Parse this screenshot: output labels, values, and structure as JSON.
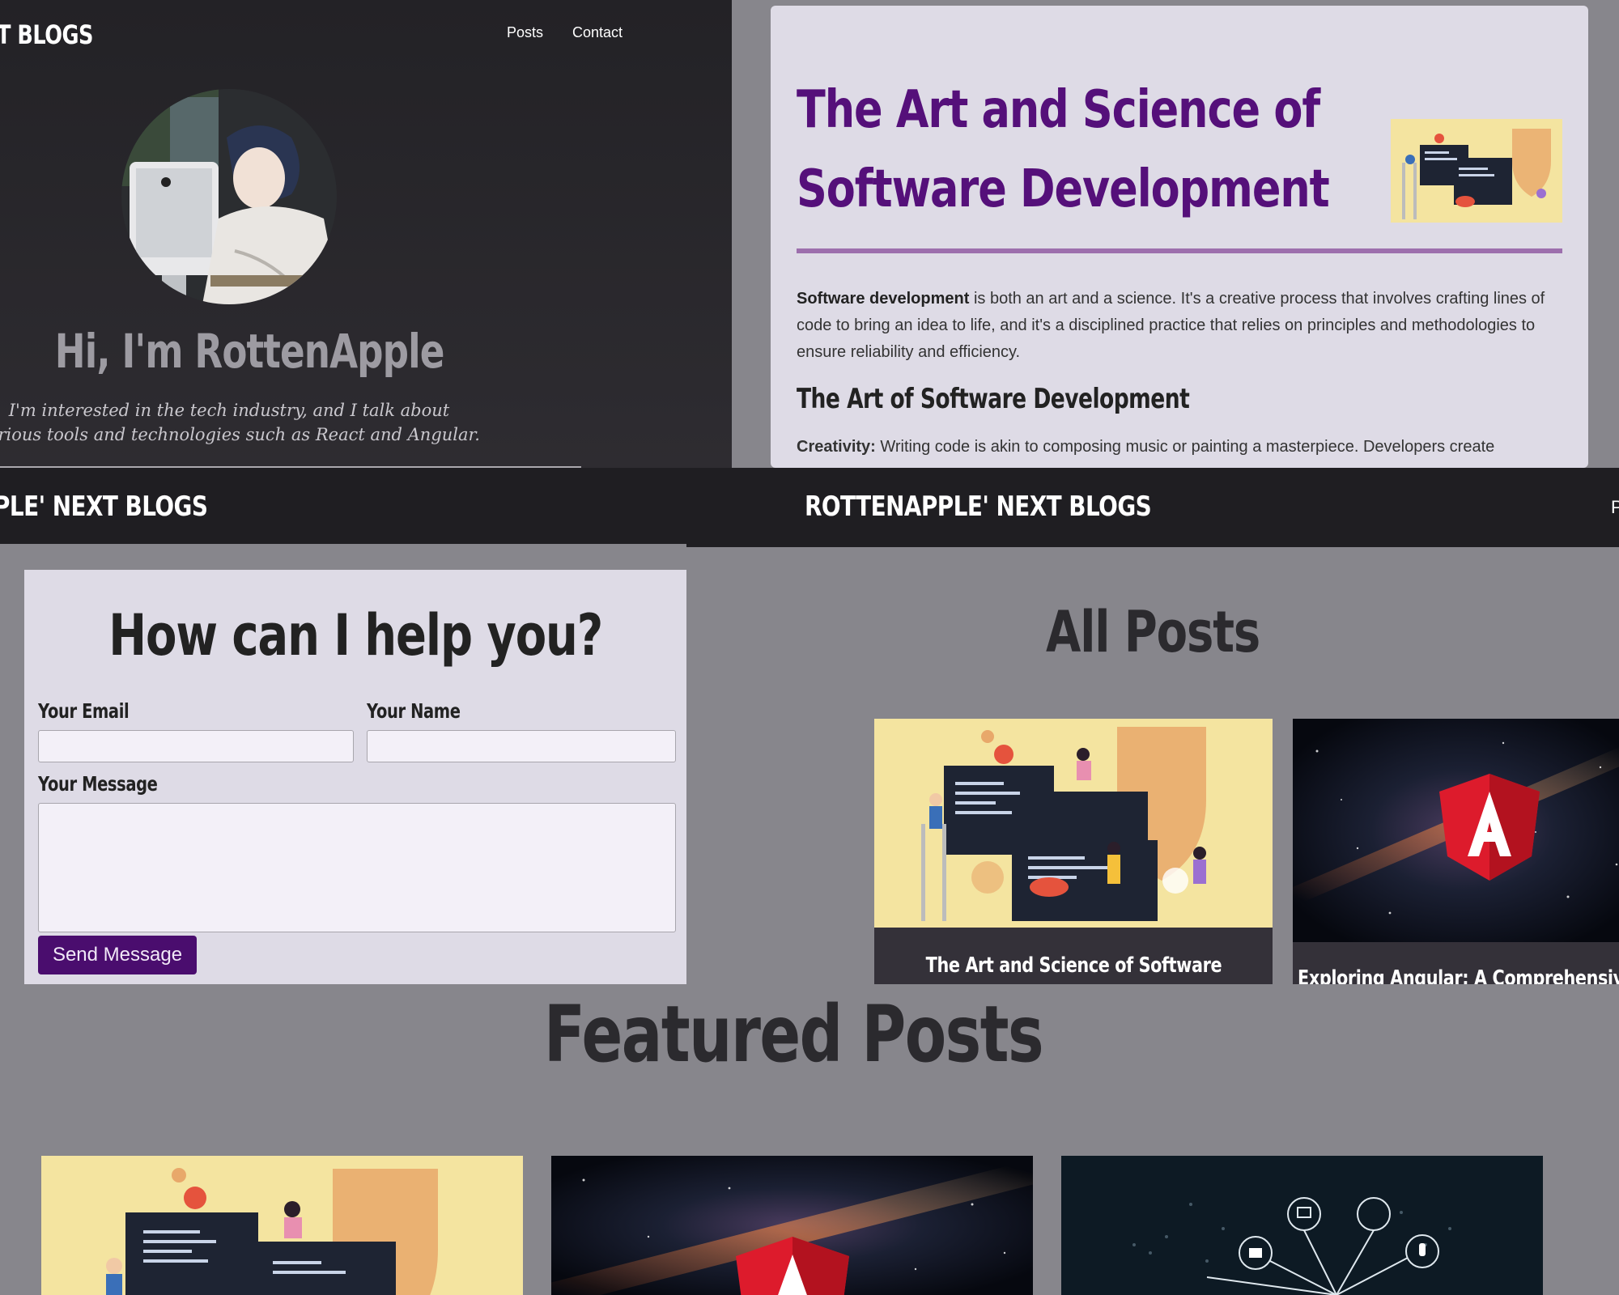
{
  "hero": {
    "brand": "T BLOGS",
    "nav": {
      "posts": "Posts",
      "contact": "Contact"
    },
    "title": "Hi, I'm RottenApple",
    "bio_line1": "I'm interested in the tech industry, and I talk about",
    "bio_line2": "various tools and technologies such as React and Angular."
  },
  "article": {
    "title_line1": "The Art and Science of",
    "title_line2": "Software Development",
    "p1_bold": "Software development",
    "p1_rest": " is both an art and a science. It's a creative process that involves crafting lines of code to bring an idea to life, and it's a disciplined practice that relies on principles and methodologies to ensure reliability and efficiency.",
    "h2": "The Art of Software Development",
    "p2_bold": "Creativity:",
    "p2_rest": " Writing code is akin to composing music or painting a masterpiece. Developers create"
  },
  "contact": {
    "brand": "PLE' NEXT BLOGS",
    "title": "How can I help you?",
    "email_label": "Your Email",
    "name_label": "Your Name",
    "message_label": "Your Message",
    "email_value": "",
    "name_value": "",
    "message_value": "",
    "send_label": "Send Message"
  },
  "all_posts": {
    "brand": "ROTTENAPPLE' NEXT BLOGS",
    "nav_partial": "P",
    "title": "All Posts",
    "cards": [
      {
        "caption": "The Art and Science of Software"
      },
      {
        "caption": "Exploring Angular: A Comprehensive"
      }
    ]
  },
  "featured": {
    "title": "Featured Posts"
  },
  "colors": {
    "accent_purple": "#55107a",
    "button_purple": "#4a0d6e",
    "page_gray": "#87868c",
    "header_dark": "#1f1e22"
  }
}
